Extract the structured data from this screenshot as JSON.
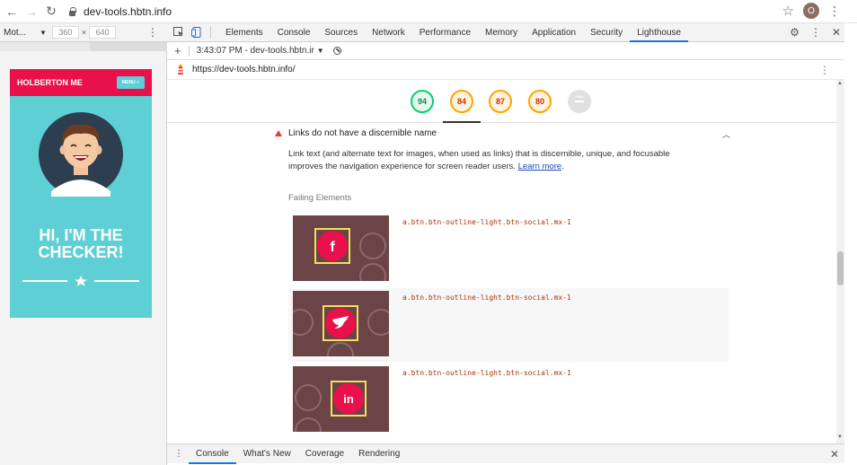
{
  "browser": {
    "address": "dev-tools.hbtn.info",
    "profile_initial": "O"
  },
  "device_toolbar": {
    "device": "Mot...",
    "width": "360",
    "times": "×",
    "height": "640"
  },
  "phone": {
    "brand": "HOLBERTON ME",
    "menu": "MENU ≡",
    "hero_line1": "HI, I'M THE",
    "hero_line2": "CHECKER!"
  },
  "devtools": {
    "tabs": [
      "Elements",
      "Console",
      "Sources",
      "Network",
      "Performance",
      "Memory",
      "Application",
      "Security",
      "Lighthouse"
    ],
    "active_tab": "Lighthouse"
  },
  "report": {
    "selector": "3:43:07 PM - dev-tools.hbtn.ir",
    "url": "https://dev-tools.hbtn.info/"
  },
  "scores": [
    {
      "value": "94",
      "status": "green"
    },
    {
      "value": "84",
      "status": "orange"
    },
    {
      "value": "87",
      "status": "orange"
    },
    {
      "value": "80",
      "status": "orange"
    },
    {
      "value": "PWA",
      "status": "gray"
    }
  ],
  "audit": {
    "title": "Links do not have a discernible name",
    "description": "Link text (and alternate text for images, when used as links) that is discernible, unique, and focusable improves the navigation experience for screen reader users.",
    "learn_more": "Learn more",
    "failing_heading": "Failing Elements",
    "failing": [
      {
        "selector": "a.btn.btn-outline-light.btn-social.mx-1",
        "icon": "f"
      },
      {
        "selector": "a.btn.btn-outline-light.btn-social.mx-1",
        "icon": "twitter"
      },
      {
        "selector": "a.btn.btn-outline-light.btn-social.mx-1",
        "icon": "in"
      }
    ]
  },
  "drawer": {
    "tabs": [
      "Console",
      "What's New",
      "Coverage",
      "Rendering"
    ],
    "active": "Console"
  },
  "colors": {
    "accent": "#1a73e8",
    "brand_red": "#e8114b",
    "teal": "#5ecfd5",
    "score_green": "#0cce6b",
    "score_orange": "#ffa400"
  }
}
